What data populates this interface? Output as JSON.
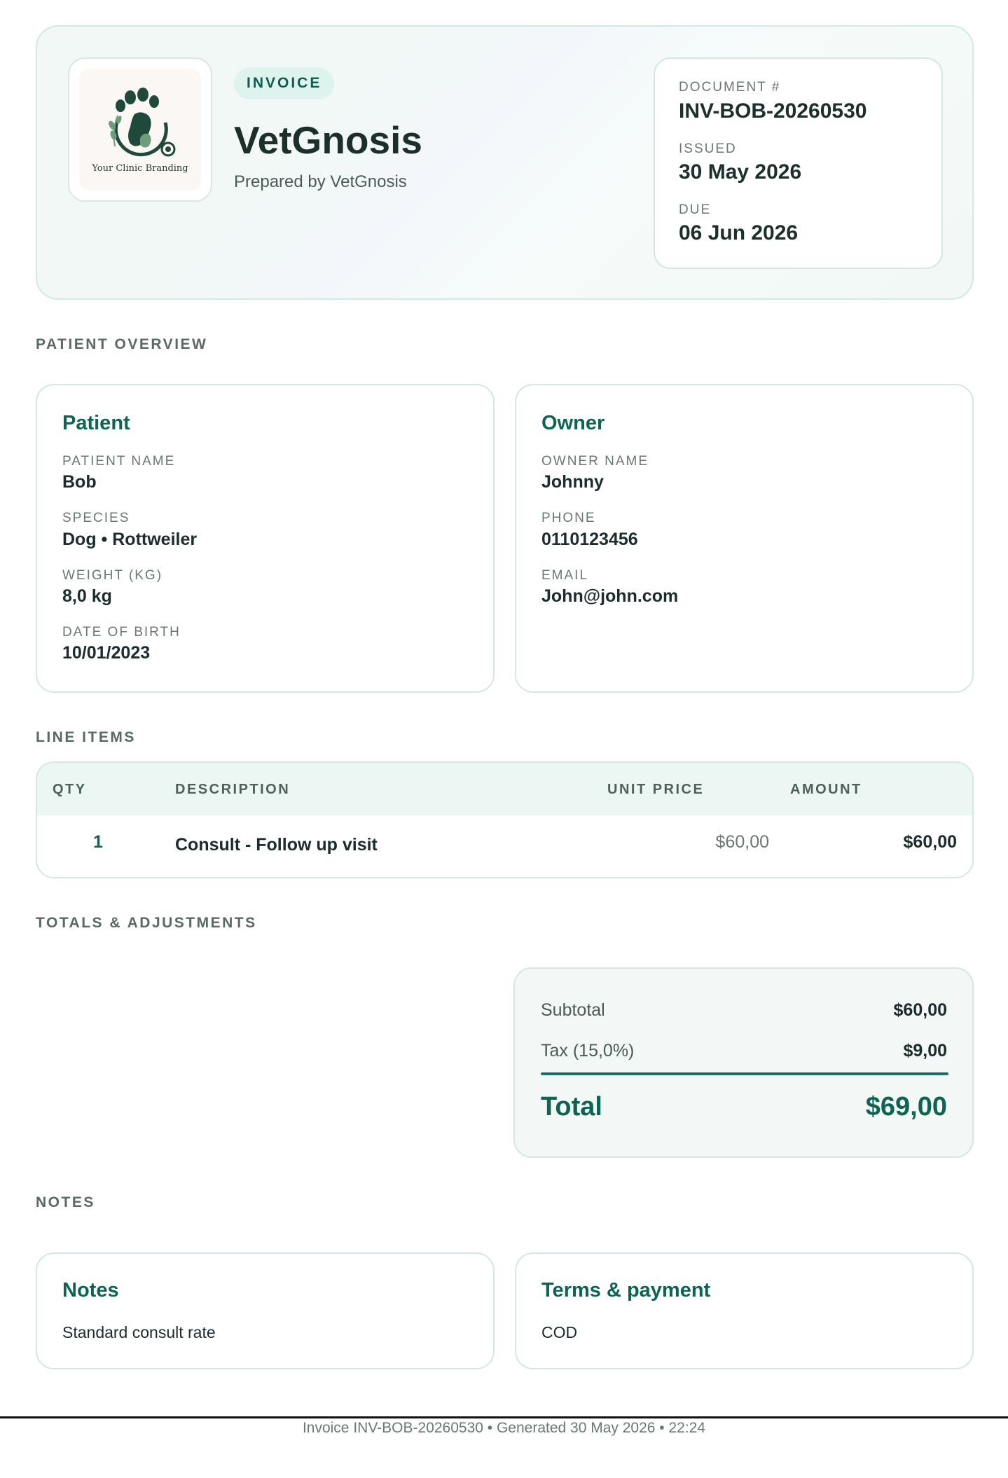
{
  "header": {
    "badge": "INVOICE",
    "clinic_name": "VetGnosis",
    "prepared_by": "Prepared by VetGnosis",
    "logo_text": "Your Clinic Branding",
    "document_label": "DOCUMENT #",
    "document_number": "INV-BOB-20260530",
    "issued_label": "ISSUED",
    "issued_date": "30 May 2026",
    "due_label": "DUE",
    "due_date": "06 Jun 2026"
  },
  "sections": {
    "patient_overview": "PATIENT OVERVIEW",
    "line_items": "LINE ITEMS",
    "totals": "TOTALS & ADJUSTMENTS",
    "notes": "NOTES"
  },
  "patient": {
    "heading": "Patient",
    "name_label": "PATIENT NAME",
    "name": "Bob",
    "species_label": "SPECIES",
    "species": "Dog • Rottweiler",
    "weight_label": "WEIGHT (KG)",
    "weight": "8,0 kg",
    "dob_label": "DATE OF BIRTH",
    "dob": "10/01/2023"
  },
  "owner": {
    "heading": "Owner",
    "name_label": "OWNER NAME",
    "name": "Johnny",
    "phone_label": "PHONE",
    "phone": "0110123456",
    "email_label": "EMAIL",
    "email": "John@john.com"
  },
  "line_items": {
    "columns": [
      "QTY",
      "DESCRIPTION",
      "UNIT PRICE",
      "AMOUNT"
    ],
    "rows": [
      {
        "qty": "1",
        "description": "Consult - Follow up visit",
        "unit_price": "$60,00",
        "amount": "$60,00"
      }
    ]
  },
  "totals": {
    "subtotal_label": "Subtotal",
    "subtotal": "$60,00",
    "tax_label": "Tax (15,0%)",
    "tax": "$9,00",
    "total_label": "Total",
    "total": "$69,00"
  },
  "notes": {
    "heading": "Notes",
    "text": "Standard consult rate"
  },
  "terms": {
    "heading": "Terms & payment",
    "text": "COD"
  },
  "footer": {
    "text": "Invoice INV-BOB-20260530 • Generated 30 May 2026 • 22:24"
  },
  "colors": {
    "accent": "#0f6352",
    "border": "#d4e7e1",
    "badge_bg": "#def2ee"
  }
}
